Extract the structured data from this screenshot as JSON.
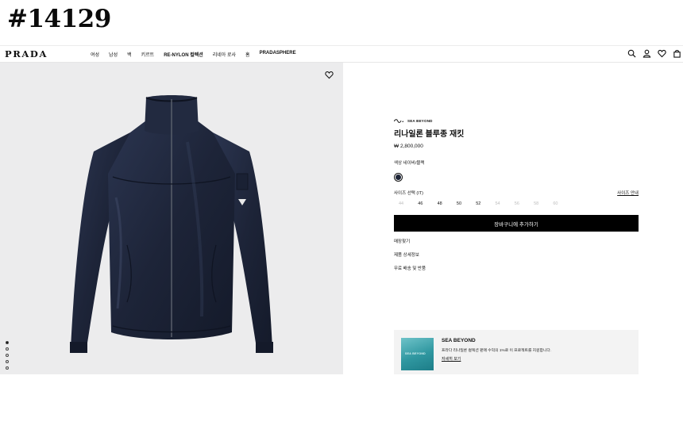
{
  "watermark": "#14129",
  "header": {
    "logo": "PRADA",
    "nav": [
      "여성",
      "남성",
      "백",
      "키르트",
      "RE-NYLON 컬렉션",
      "리네아 로사",
      "홈",
      "PRADASPHERE"
    ],
    "icons": [
      "search-icon",
      "account-icon",
      "wishlist-icon",
      "bag-icon"
    ]
  },
  "product": {
    "brand_tag": "SEA BEYOND",
    "title": "리나일론 블루종 재킷",
    "price": "₩ 2,800,000",
    "color_label": "색상  네이비/블랙",
    "color_hex": "#1c2336",
    "size_label": "사이즈 선택 (IT)",
    "size_guide": "사이즈 안내",
    "sizes": [
      {
        "label": "44",
        "available": false
      },
      {
        "label": "46",
        "available": true
      },
      {
        "label": "48",
        "available": true
      },
      {
        "label": "50",
        "available": true
      },
      {
        "label": "52",
        "available": true
      },
      {
        "label": "54",
        "available": false
      },
      {
        "label": "56",
        "available": false
      },
      {
        "label": "58",
        "available": false
      },
      {
        "label": "60",
        "available": false
      }
    ],
    "add_to_cart": "장바구니에 추가하기",
    "links": [
      "매장찾기",
      "제품 상세정보",
      "무료 배송 및 반품"
    ]
  },
  "gallery": {
    "dots": 5,
    "active_dot": 0
  },
  "sea_beyond": {
    "image_label": "SEA BEYOND",
    "title": "SEA BEYOND",
    "text": "프라다 리나일론 컬렉션 판매 수익의 1%로 이 프로젝트를 지원합니다.",
    "link": "자세히 보기"
  },
  "colors": {
    "accent": "#000000",
    "gallery_bg": "#ececed",
    "card_bg": "#f3f3f3"
  }
}
